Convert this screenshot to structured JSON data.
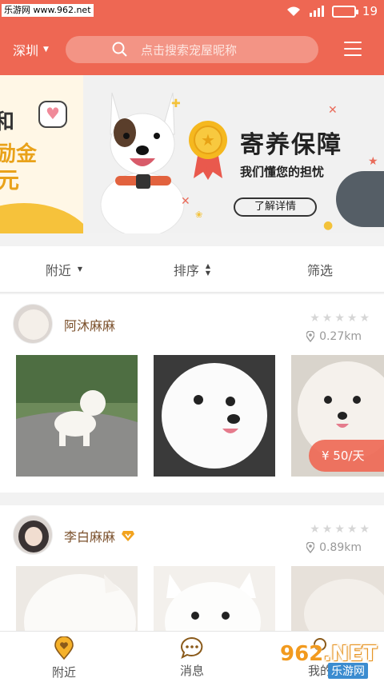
{
  "status_bar": {
    "watermark": "乐游网 www.962.net",
    "battery_level": "19"
  },
  "header": {
    "city": "深圳",
    "search_placeholder": "点击搜索宠屋昵称"
  },
  "banner": {
    "left_partial": [
      "和",
      "励金",
      "元"
    ],
    "title": "寄养保障",
    "subtitle": "我们懂您的担忧",
    "button": "了解详情"
  },
  "filters": [
    {
      "label": "附近"
    },
    {
      "label": "排序"
    },
    {
      "label": "筛选"
    }
  ],
  "cards": [
    {
      "owner": "阿沐麻麻",
      "distance": "0.27km",
      "price": "¥ 50/天",
      "rating": 0
    },
    {
      "owner": "李白麻麻",
      "distance": "0.89km",
      "rating": 0
    }
  ],
  "bottom_nav": [
    {
      "label": "附近",
      "icon": "location-heart-icon"
    },
    {
      "label": "消息",
      "icon": "chat-bubble-icon"
    },
    {
      "label": "我的",
      "icon": "profile-icon"
    }
  ],
  "site_logo": {
    "number": "962",
    "suffix": ".NET",
    "caption": "乐游网"
  },
  "colors": {
    "brand": "#ee6753",
    "accent_gold": "#e9a21a",
    "text_brown": "#7a4f2a"
  }
}
